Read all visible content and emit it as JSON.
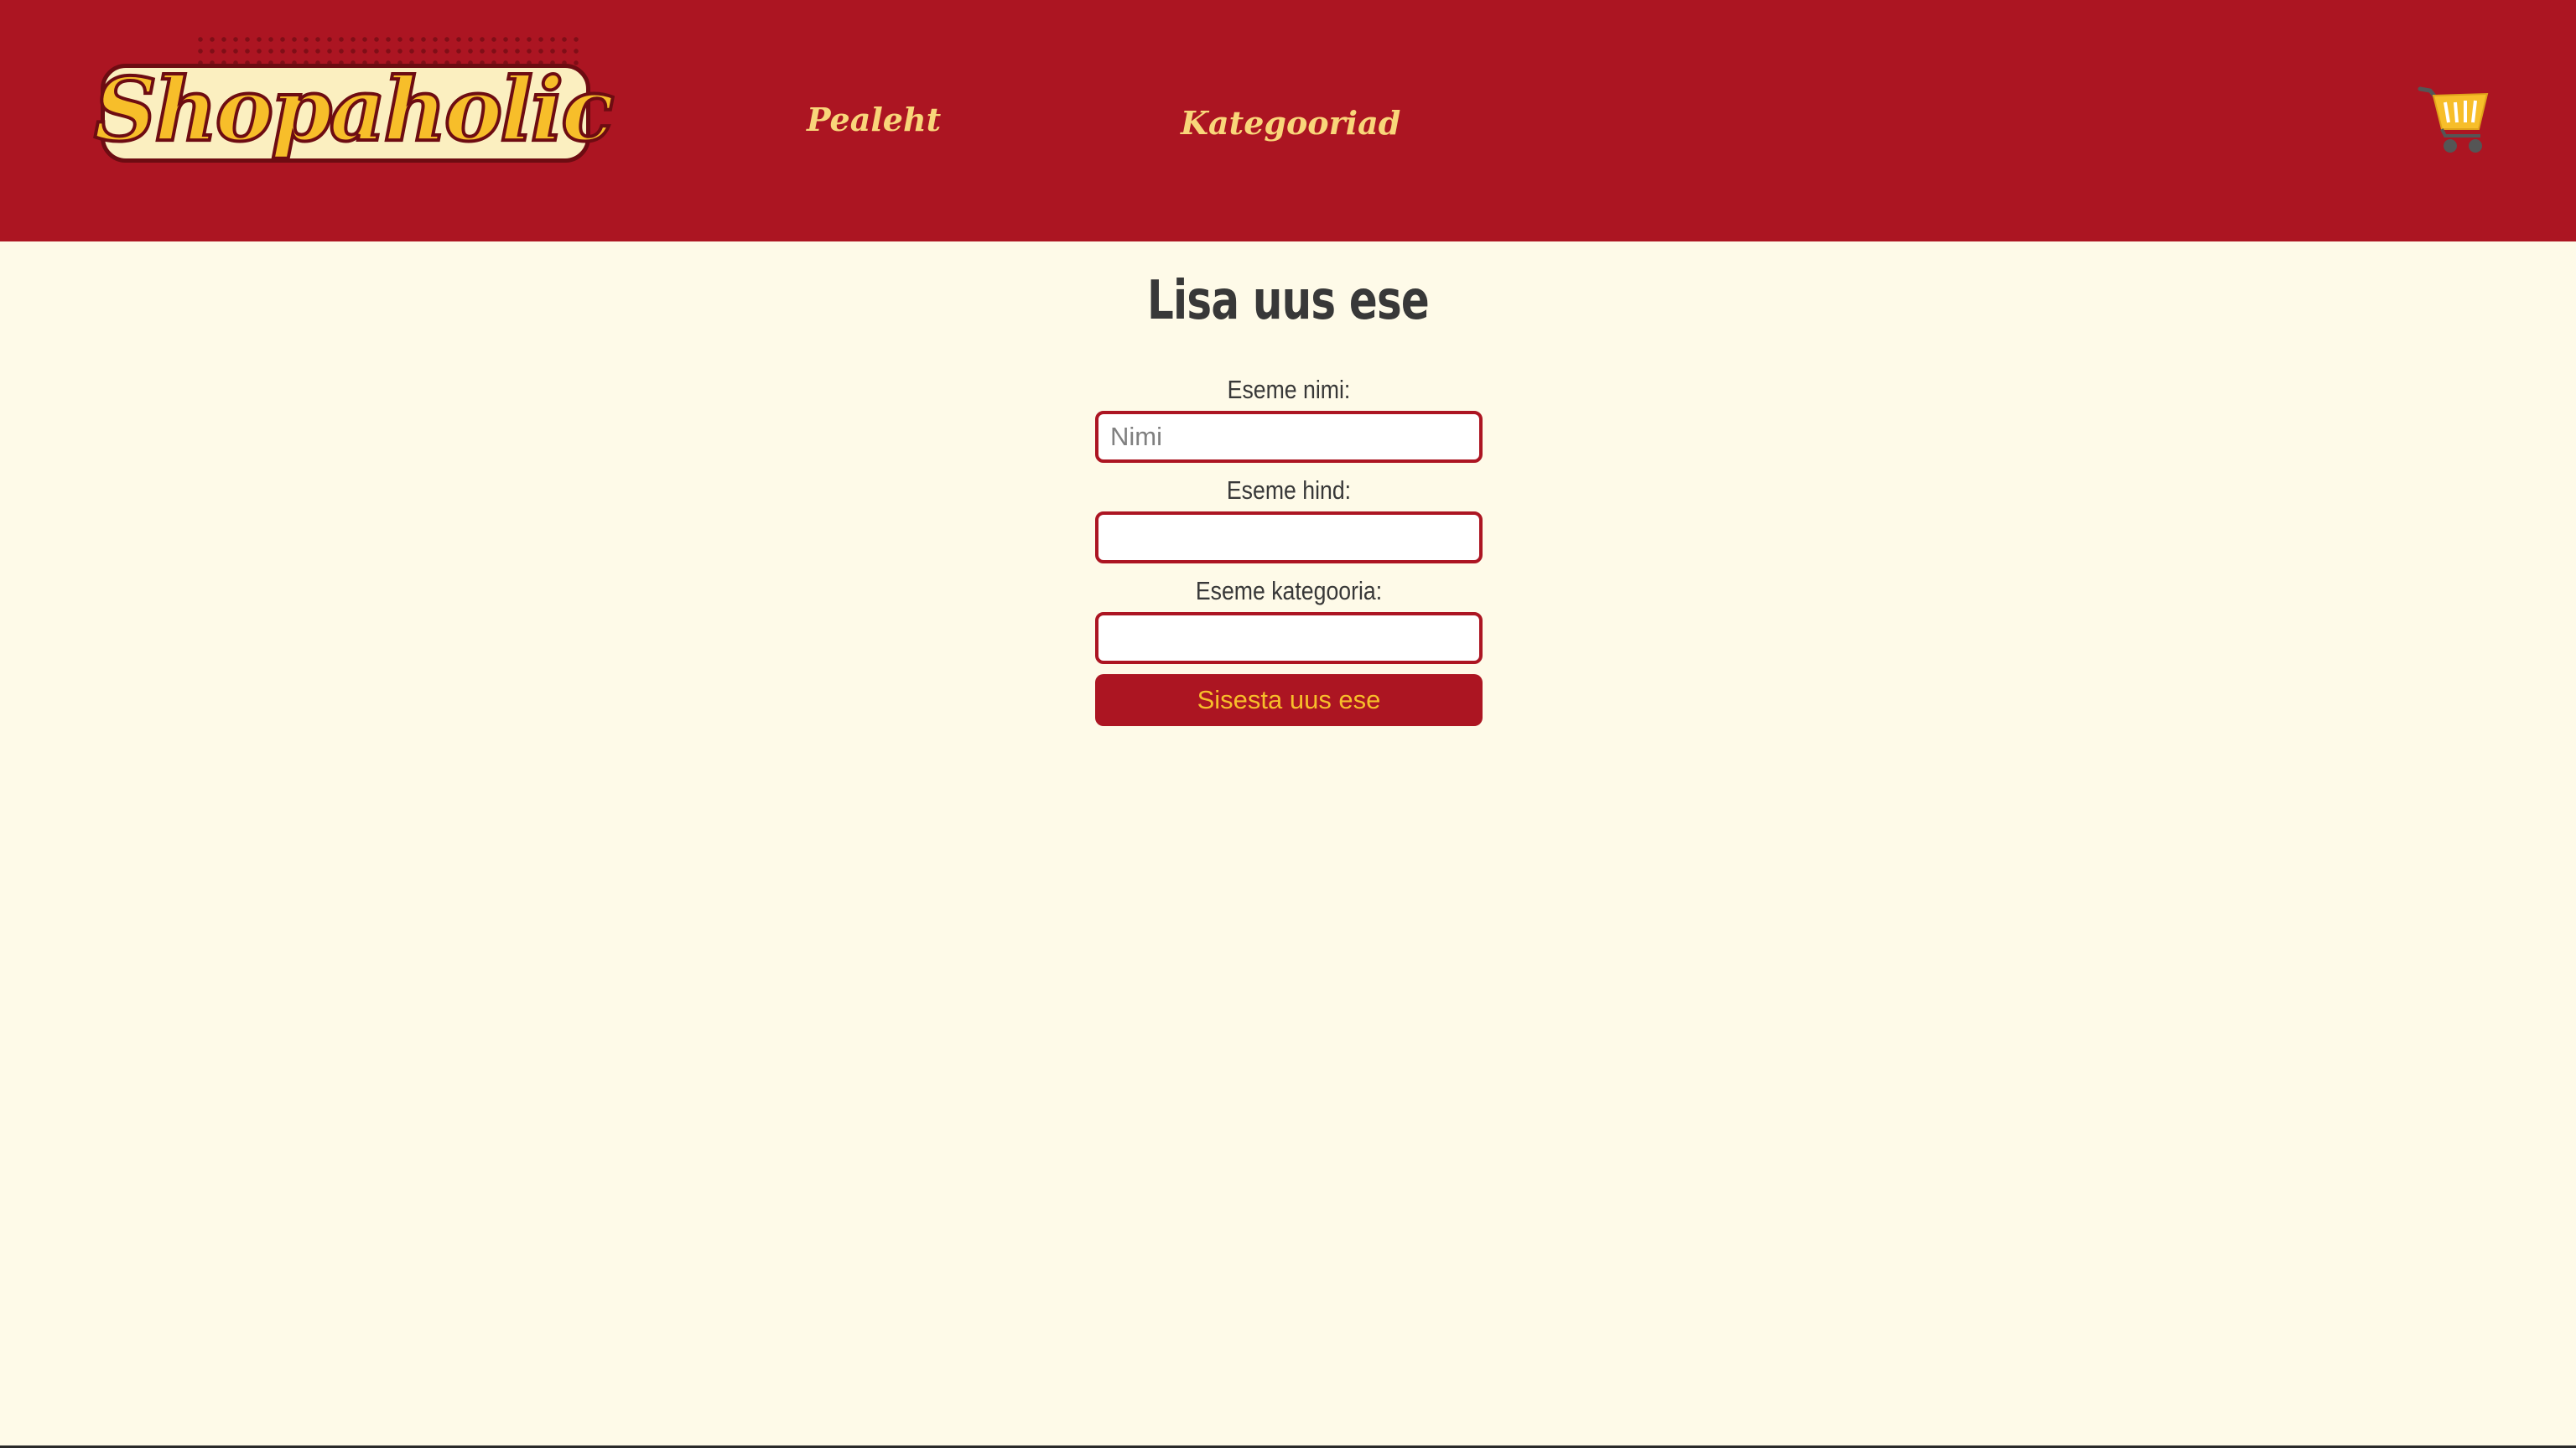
{
  "brand": {
    "logo_text": "Shopaholic"
  },
  "nav": {
    "home_label": "Pealeht",
    "categories_label": "Kategooriad"
  },
  "cart": {
    "icon": "shopping-cart-icon"
  },
  "page": {
    "title": "Lisa uus ese"
  },
  "form": {
    "name_label": "Eseme nimi:",
    "name_placeholder": "Nimi",
    "name_value": "",
    "price_label": "Eseme hind:",
    "price_value": "",
    "category_label": "Eseme kategooria:",
    "category_value": "",
    "submit_label": "Sisesta uus ese"
  },
  "colors": {
    "header_bg": "#ac1522",
    "page_bg": "#fefae8",
    "accent_yellow": "#f7be2a",
    "nav_text": "#f9d67a",
    "body_text": "#383838"
  }
}
